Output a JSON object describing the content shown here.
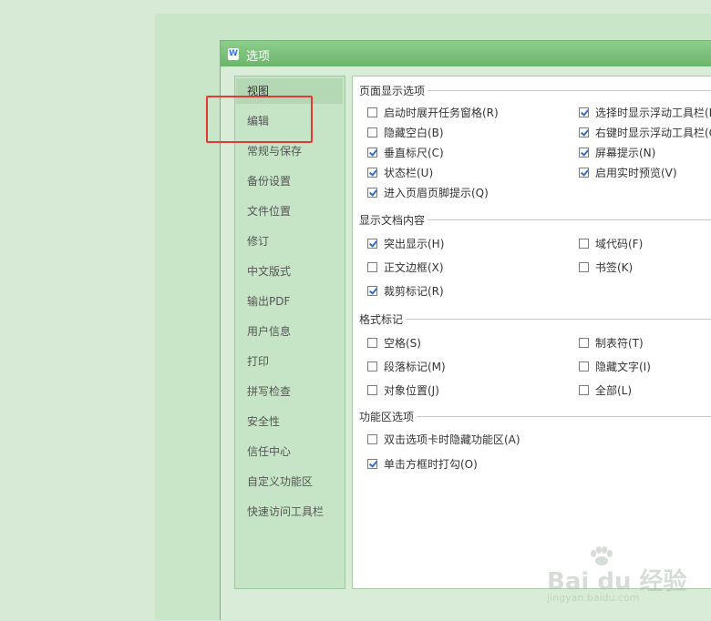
{
  "window": {
    "title": "选项"
  },
  "sidebar": {
    "items": [
      {
        "label": "视图",
        "active": true
      },
      {
        "label": "编辑"
      },
      {
        "label": "常规与保存"
      },
      {
        "label": "备份设置"
      },
      {
        "label": "文件位置"
      },
      {
        "label": "修订"
      },
      {
        "label": "中文版式"
      },
      {
        "label": "输出PDF"
      },
      {
        "label": "用户信息"
      },
      {
        "label": "打印"
      },
      {
        "label": "拼写检查"
      },
      {
        "label": "安全性"
      },
      {
        "label": "信任中心"
      },
      {
        "label": "自定义功能区"
      },
      {
        "label": "快速访问工具栏"
      }
    ]
  },
  "sections": {
    "page_display": {
      "title": "页面显示选项",
      "options": [
        {
          "label": "启动时展开任务窗格(R)",
          "checked": false
        },
        {
          "label": "选择时显示浮动工具栏(D)",
          "checked": true
        },
        {
          "label": "隐藏空白(B)",
          "checked": false
        },
        {
          "label": "右键时显示浮动工具栏(G)",
          "checked": true
        },
        {
          "label": "垂直标尺(C)",
          "checked": true
        },
        {
          "label": "屏幕提示(N)",
          "checked": true
        },
        {
          "label": "状态栏(U)",
          "checked": true
        },
        {
          "label": "启用实时预览(V)",
          "checked": true
        },
        {
          "label": "进入页眉页脚提示(Q)",
          "checked": true
        }
      ]
    },
    "doc_content": {
      "title": "显示文档内容",
      "options": [
        {
          "label": "突出显示(H)",
          "checked": true
        },
        {
          "label": "域代码(F)",
          "checked": false
        },
        {
          "label": "正文边框(X)",
          "checked": false
        },
        {
          "label": "书签(K)",
          "checked": false
        },
        {
          "label": "裁剪标记(R)",
          "checked": true
        }
      ]
    },
    "format_marks": {
      "title": "格式标记",
      "options": [
        {
          "label": "空格(S)",
          "checked": false
        },
        {
          "label": "制表符(T)",
          "checked": false
        },
        {
          "label": "段落标记(M)",
          "checked": false
        },
        {
          "label": "隐藏文字(I)",
          "checked": false
        },
        {
          "label": "对象位置(J)",
          "checked": false
        },
        {
          "label": "全部(L)",
          "checked": false
        }
      ]
    },
    "ribbon": {
      "title": "功能区选项",
      "options": [
        {
          "label": "双击选项卡时隐藏功能区(A)",
          "checked": false
        },
        {
          "label": "单击方框时打勾(O)",
          "checked": true
        }
      ]
    }
  },
  "watermark": {
    "brand": "Bai du 经验",
    "url": "jingyan.baidu.com"
  },
  "colors": {
    "highlight": "#e53935",
    "titlebar": "#6cb56c",
    "check": "#2c6ec8"
  }
}
